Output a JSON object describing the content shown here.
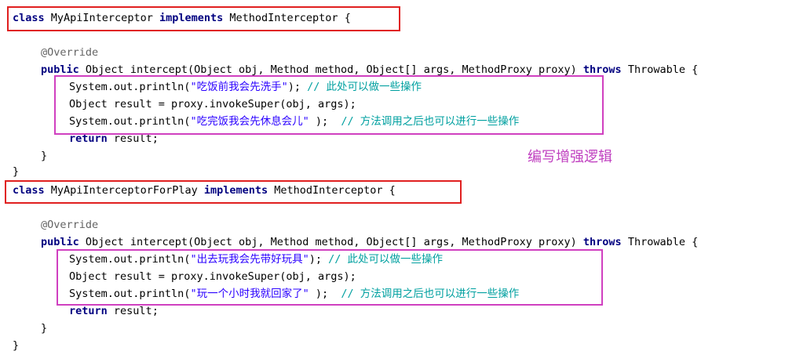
{
  "colors": {
    "keyword": "#000080",
    "annotation": "#646464",
    "string": "#2a00ff",
    "comment": "#00a0a0",
    "highlight_class": "#e02020",
    "highlight_body": "#d040c0",
    "note": "#c040c0"
  },
  "note_text": "编写增强逻辑",
  "blocks": [
    {
      "kw_class": "class",
      "class_name": "MyApiInterceptor",
      "kw_implements": "implements",
      "iface_tail": "MethodInterceptor {",
      "annotation": "@Override",
      "kw_public": "public",
      "sig_mid": "Object intercept(Object obj, Method method, Object[] args, MethodProxy proxy)",
      "kw_throws": "throws",
      "sig_tail": "Throwable {",
      "print1_pre": "System.out.println(",
      "print1_str": "\"吃饭前我会先洗手\"",
      "print1_post": ");",
      "print1_cmt": "// 此处可以做一些操作",
      "invoke_line": "Object result = proxy.invokeSuper(obj, args);",
      "print2_pre": "System.out.println(",
      "print2_str": "\"吃完饭我会先休息会儿\"",
      "print2_post": " );",
      "print2_cmt": "// 方法调用之后也可以进行一些操作",
      "kw_return": "return",
      "return_tail": "result;",
      "close_method": "}",
      "close_class": "}"
    },
    {
      "kw_class": "class",
      "class_name": "MyApiInterceptorForPlay",
      "kw_implements": "implements",
      "iface_tail": "MethodInterceptor {",
      "annotation": "@Override",
      "kw_public": "public",
      "sig_mid": "Object intercept(Object obj, Method method, Object[] args, MethodProxy proxy)",
      "kw_throws": "throws",
      "sig_tail": "Throwable {",
      "print1_pre": "System.out.println(",
      "print1_str": "\"出去玩我会先带好玩具\"",
      "print1_post": ");",
      "print1_cmt": "// 此处可以做一些操作",
      "invoke_line": "Object result = proxy.invokeSuper(obj, args);",
      "print2_pre": "System.out.println(",
      "print2_str": "\"玩一个小时我就回家了\"",
      "print2_post": " );",
      "print2_cmt": "// 方法调用之后也可以进行一些操作",
      "kw_return": "return",
      "return_tail": "result;",
      "close_method": "}",
      "close_class": "}"
    }
  ]
}
